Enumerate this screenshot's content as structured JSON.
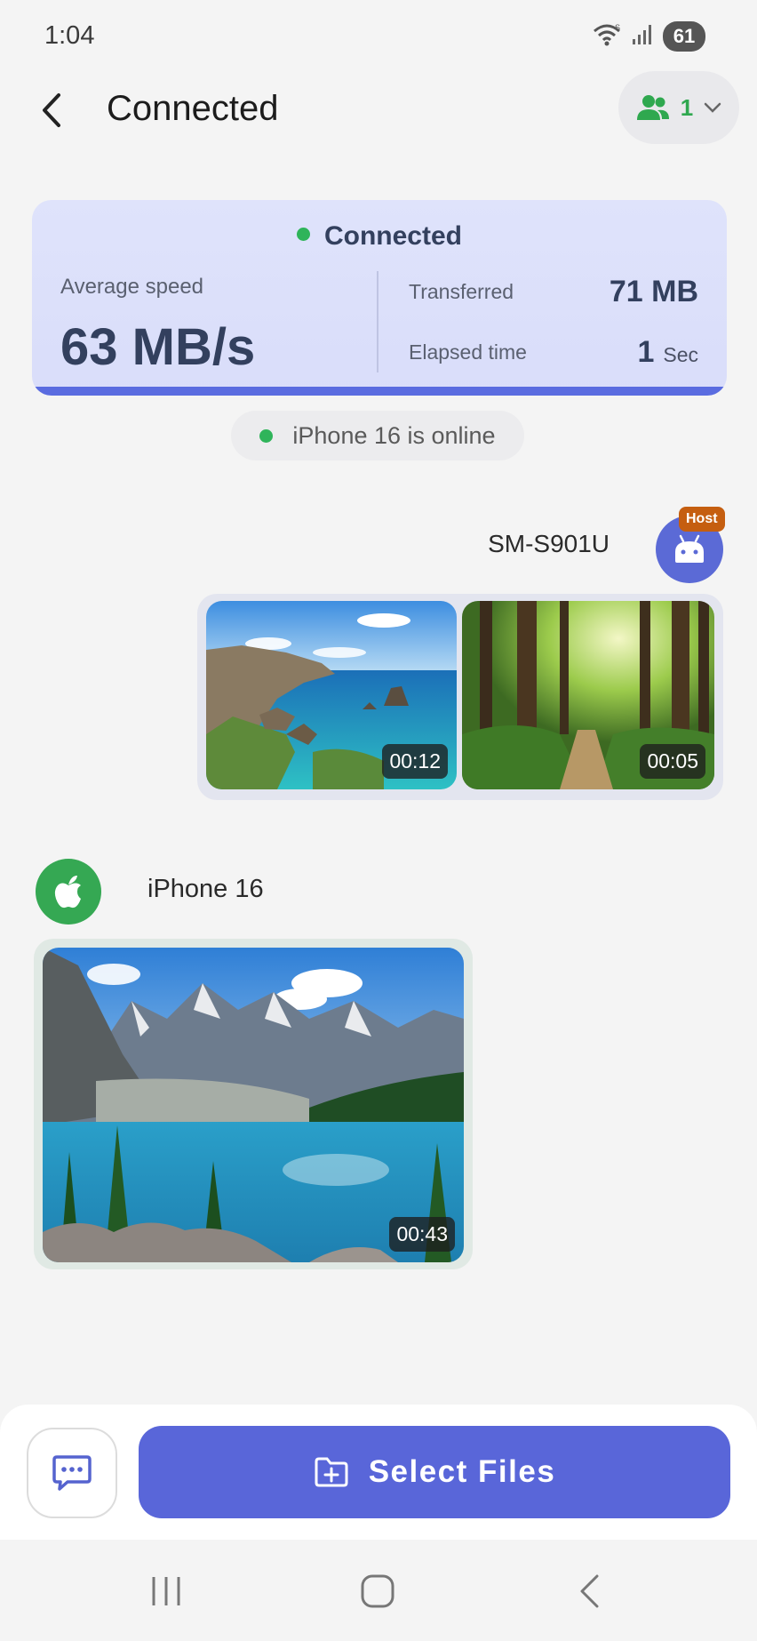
{
  "status_bar": {
    "time": "1:04",
    "battery": "61",
    "icons": [
      "wifi-icon",
      "signal-icon",
      "battery-icon"
    ]
  },
  "header": {
    "title": "Connected",
    "participants_count": "1",
    "icons": [
      "back-arrow-icon",
      "people-icon",
      "chevron-down-icon"
    ]
  },
  "connection_card": {
    "status": "Connected",
    "average_speed_label": "Average speed",
    "average_speed_value": "63 MB/s",
    "transferred_label": "Transferred",
    "transferred_value": "71 MB",
    "elapsed_label": "Elapsed time",
    "elapsed_value": "1",
    "elapsed_unit": "Sec",
    "accent_color": "#5a6ce0",
    "status_color": "#2fb45a"
  },
  "online_status": "iPhone 16 is online",
  "host_device": {
    "name": "SM-S901U",
    "badge": "Host",
    "icon": "android-icon",
    "media": [
      {
        "description": "coastal-cliffs-video",
        "duration": "00:12"
      },
      {
        "description": "forest-path-video",
        "duration": "00:05"
      }
    ]
  },
  "peer_device": {
    "name": "iPhone 16",
    "icon": "apple-icon",
    "media": [
      {
        "description": "mountain-lake-video",
        "duration": "00:43"
      }
    ]
  },
  "actions": {
    "chat_icon": "chat-icon",
    "select_files_label": "Select Files",
    "select_files_icon": "folder-add-icon",
    "button_color": "#5966d9"
  },
  "nav_bar": [
    "recents-icon",
    "home-icon",
    "back-icon"
  ]
}
